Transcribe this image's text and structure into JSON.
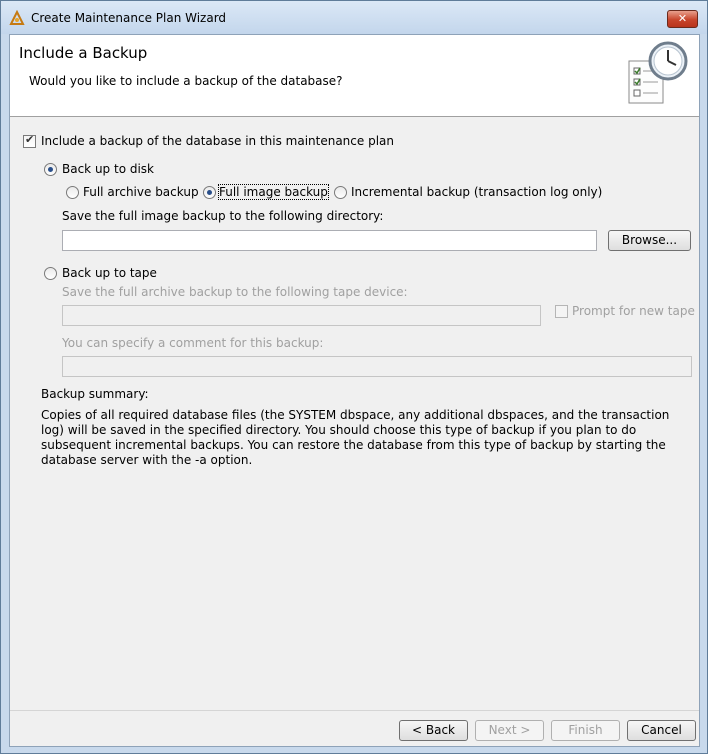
{
  "window": {
    "title": "Create Maintenance Plan Wizard",
    "close_glyph": "✕",
    "title_icon": "wizard-icon"
  },
  "header": {
    "title": "Include a Backup",
    "subtitle": "Would you like to include a backup of the database?",
    "icon": "clock-checklist-icon"
  },
  "options": {
    "include_backup": {
      "label": "Include a backup of the database in this maintenance plan",
      "checked": true
    },
    "backup_to_disk": {
      "label": "Back up to disk",
      "selected": true
    },
    "full_archive": {
      "label": "Full archive backup",
      "selected": false
    },
    "full_image": {
      "label": "Full image backup",
      "selected": true
    },
    "incremental": {
      "label": "Incremental backup (transaction log only)",
      "selected": false
    },
    "directory_label": "Save the full image backup to the following directory:",
    "directory_value": "",
    "browse_label": "Browse...",
    "backup_to_tape": {
      "label": "Back up to tape",
      "selected": false
    },
    "tape_device_label": "Save the full archive backup to the following tape device:",
    "tape_device_value": "",
    "prompt_new_tape": {
      "label": "Prompt for new tape",
      "checked": false
    },
    "comment_label": "You can specify a comment for this backup:",
    "comment_value": ""
  },
  "summary": {
    "heading": "Backup summary:",
    "text": "Copies of all required database files (the SYSTEM dbspace, any additional dbspaces, and the transaction log) will be saved in the specified directory. You should choose this type of backup if you plan to do subsequent incremental backups. You can restore the database from this type of backup by starting the database server with the -a option."
  },
  "footer": {
    "back": "< Back",
    "next": "Next >",
    "finish": "Finish",
    "cancel": "Cancel"
  },
  "colors": {
    "frame": "#c8d9ec",
    "client": "#f0f0f0",
    "close": "#c8452b"
  }
}
